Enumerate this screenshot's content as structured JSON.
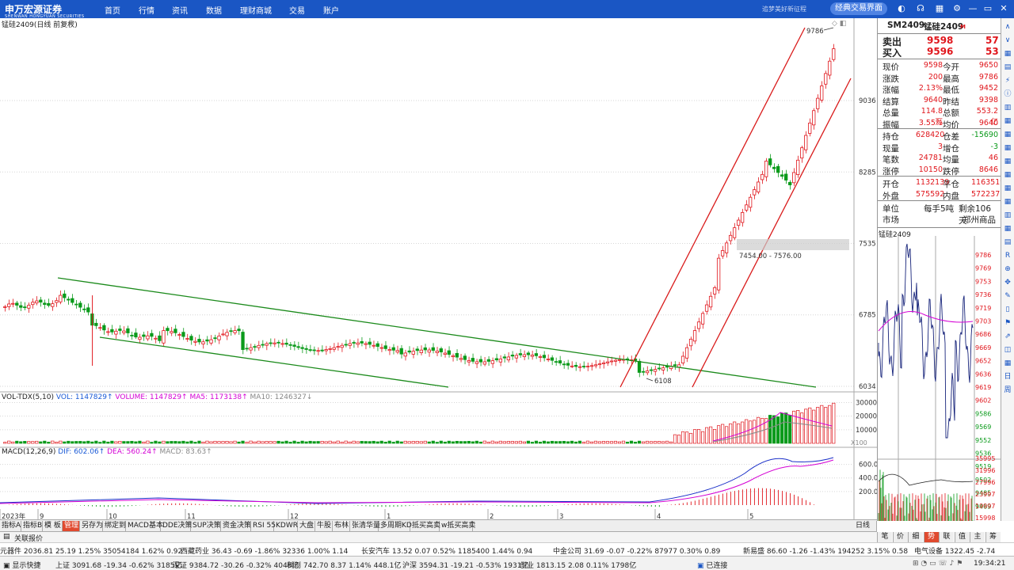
{
  "app": {
    "logo_text": "申万宏源证券",
    "logo_sub": "SHENWAN HONGYUAN SECURITIES",
    "nav": [
      "首页",
      "行情",
      "资讯",
      "数据",
      "理财商城",
      "交易",
      "账户"
    ],
    "slogan": "追梦美好新征程",
    "classic_button": "经典交易界面"
  },
  "chart": {
    "title": "锰硅2409(日线 前复权)",
    "y_ticks": [
      "9036",
      "8285",
      "7535",
      "6785",
      "6034"
    ],
    "max_label": "9786",
    "min_label": "6108",
    "range_label": "7454.00 - 7576.00",
    "x_labels": [
      "2023年",
      "9",
      "10",
      "11",
      "12",
      "1",
      "2",
      "3",
      "4",
      "5"
    ],
    "period_label": "日线"
  },
  "volume": {
    "title": "VOL-TDX(5,10)",
    "vol": "VOL: 1147829↑",
    "volume": "VOLUME: 1147829↑",
    "ma5": "MA5: 1173138↑",
    "ma10": "MA10: 1246327↓",
    "y_ticks": [
      "30000",
      "20000",
      "10000"
    ],
    "unit": "X100"
  },
  "macd": {
    "title": "MACD(12,26,9)",
    "dif": "DIF: 602.06↑",
    "dea": "DEA: 560.24↑",
    "macd": "MACD: 83.63↑",
    "y_ticks": [
      "600.0",
      "400.0",
      "200.0"
    ]
  },
  "quote": {
    "header_code": "SM2409",
    "header_name": "锰硅2409",
    "header_flag": "M",
    "sell": {
      "label": "卖出",
      "price": "9598",
      "qty": "57"
    },
    "buy": {
      "label": "买入",
      "price": "9596",
      "qty": "53"
    },
    "rows1": [
      [
        "现价",
        "9598",
        "今开",
        "9650"
      ],
      [
        "涨跌",
        "200",
        "最高",
        "9786"
      ],
      [
        "涨幅",
        "2.13%",
        "最低",
        "9452"
      ],
      [
        "结算",
        "9640",
        "昨结",
        "9398"
      ],
      [
        "总量",
        "114.8万",
        "总额",
        "553.2亿"
      ],
      [
        "振幅",
        "3.55%",
        "均价",
        "9640"
      ]
    ],
    "rows2": [
      [
        "持仓",
        "628420",
        "仓差",
        "-15690"
      ],
      [
        "现量",
        "3",
        "增仓",
        "-3"
      ],
      [
        "笔数",
        "24781",
        "均量",
        "46"
      ],
      [
        "涨停",
        "10150",
        "跌停",
        "8646"
      ]
    ],
    "rows3": [
      [
        "开仓",
        "1132139",
        "平仓",
        "1163519"
      ],
      [
        "外盘",
        "575592",
        "内盘",
        "572237"
      ]
    ],
    "unit_label": "单位",
    "unit_value": "每手5吨",
    "remain": "剩余106天",
    "market_label": "市场",
    "market_value": "郑州商品"
  },
  "minichart": {
    "title": "锰硅2409",
    "price_ticks": [
      "9786",
      "9769",
      "9753",
      "9736",
      "9719",
      "9703",
      "9686",
      "9669",
      "9652",
      "9636",
      "9619",
      "9602",
      "9586",
      "9569",
      "9552",
      "9536",
      "9519",
      "9502",
      "9485",
      "9469"
    ],
    "vol_ticks": [
      "35995",
      "31996",
      "27996",
      "23997",
      "19997",
      "15998",
      "11998",
      "7999",
      "3999"
    ]
  },
  "tabs": [
    "指标A",
    "指标B",
    "模 板",
    "管理",
    "另存为",
    "绑定到",
    "MACD基本",
    "DDE决策",
    "SUP决策",
    "资金决策",
    "RSI 55",
    "KDWR",
    "大盘",
    "牛股",
    "布林",
    "张清华量",
    "多周期KD",
    "抵买高卖",
    "w抵买高卖"
  ],
  "active_tab": "管理",
  "right_tabs": [
    "笔",
    "价",
    "细",
    "势",
    "联",
    "值",
    "主",
    "筹"
  ],
  "active_right_tab": "势",
  "quote_label": "关联报价",
  "ticker": [
    "元器件  2036.81  25.19  1.25%  35054184  1.62%  0.92",
    "西藏药业  36.43  -0.69  -1.86%  32336  1.00%  1.14",
    "长安汽车  13.52  0.07  0.52%  1185400  1.44%  0.94",
    "中金公司  31.69  -0.07  -0.22%  87977  0.30%  0.89",
    "新易盛  86.60  -1.26  -1.43%  194252  3.15%  0.58",
    "电气设备  1322.45  -2.74"
  ],
  "status": {
    "shortcut": "显示快捷",
    "sh": "上证 3091.68  -19.34  -0.62%  3185亿",
    "sz": "深证 9384.72  -30.26  -0.32%  4048亿",
    "kc": "科创 742.70  8.37  1.14%  448.1亿",
    "hs": "沪深 3594.31  -19.21  -0.53%  1931亿",
    "cy": "创业 1813.15  2.08  0.11%  1798亿",
    "conn": "已连接",
    "time": "19:34:21"
  },
  "colors": {
    "brand": "#1a56c4",
    "up": "#e0161c",
    "down": "#0a9a1a",
    "trend_down": "#1b8a1b",
    "trend_up": "#d91a1a"
  }
}
